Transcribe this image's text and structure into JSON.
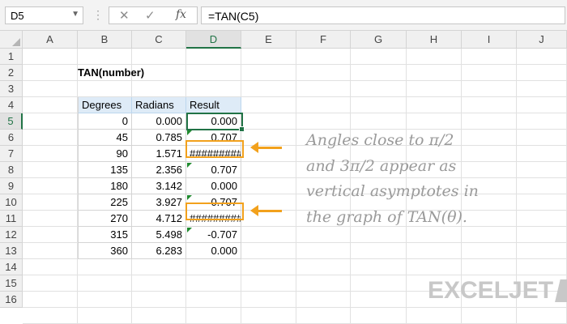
{
  "formula_bar": {
    "name_box": "D5",
    "formula": "=TAN(C5)",
    "cancel_glyph": "✕",
    "enter_glyph": "✓",
    "fx_glyph": "fx"
  },
  "columns": [
    "A",
    "B",
    "C",
    "D",
    "E",
    "F",
    "G",
    "H",
    "I",
    "J"
  ],
  "rows": [
    "1",
    "2",
    "3",
    "4",
    "5",
    "6",
    "7",
    "8",
    "9",
    "10",
    "11",
    "12",
    "13",
    "14",
    "15",
    "16"
  ],
  "title": "TAN(number)",
  "table": {
    "headers": [
      "Degrees",
      "Radians",
      "Result"
    ],
    "rows": [
      [
        "0",
        "0.000",
        "0.000"
      ],
      [
        "45",
        "0.785",
        "0.707"
      ],
      [
        "90",
        "1.571",
        "#########"
      ],
      [
        "135",
        "2.356",
        "0.707"
      ],
      [
        "180",
        "3.142",
        "0.000"
      ],
      [
        "225",
        "3.927",
        "-0.707"
      ],
      [
        "270",
        "4.712",
        "#########"
      ],
      [
        "315",
        "5.498",
        "-0.707"
      ],
      [
        "360",
        "6.283",
        "0.000"
      ]
    ]
  },
  "note": {
    "lines": [
      "Angles close to π/2",
      "and 3π/2 appear as",
      "vertical asymptotes in",
      "the graph of TAN(θ)."
    ]
  },
  "logo": {
    "text": "EXCELJET"
  },
  "colors": {
    "accent": "#217346",
    "highlight": "#f2a11c",
    "header_fill": "#deebf7",
    "note_text": "#9a9a9a"
  }
}
